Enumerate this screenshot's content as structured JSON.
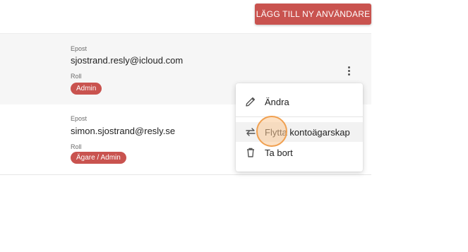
{
  "header": {
    "add_user_label": "LÄGG TILL NY ANVÄNDARE"
  },
  "users": [
    {
      "email_label": "Epost",
      "email": "sjostrand.resly@icloud.com",
      "role_label": "Roll",
      "role": "Admin"
    },
    {
      "email_label": "Epost",
      "email": "simon.sjostrand@resly.se",
      "role_label": "Roll",
      "role": "Ägare / Admin"
    }
  ],
  "menu": {
    "items": [
      {
        "label": "Ändra",
        "icon": "pencil-icon"
      },
      {
        "label": "Flytta kontoägarskap",
        "icon": "swap-arrows-icon"
      },
      {
        "label": "Ta bort",
        "icon": "trash-icon"
      }
    ]
  },
  "colors": {
    "accent": "#c9534f",
    "cursor_halo": "#f0a050"
  }
}
